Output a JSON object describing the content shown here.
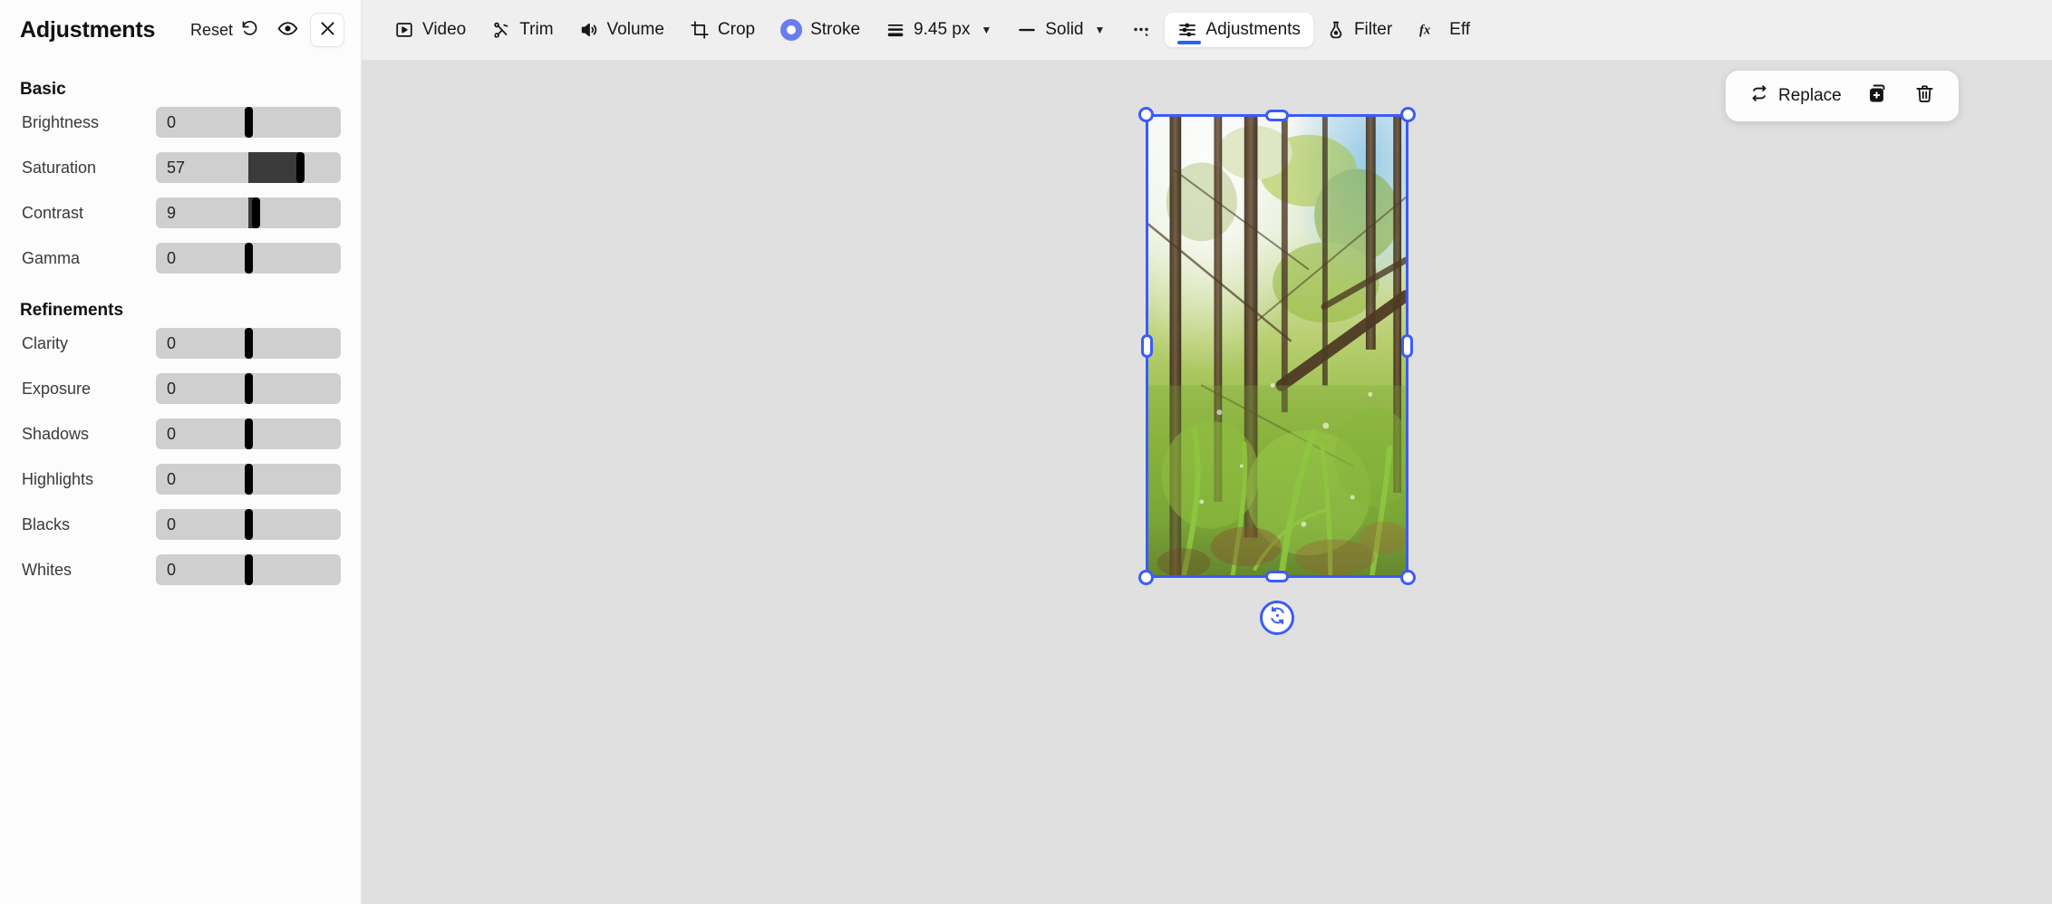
{
  "panel": {
    "title": "Adjustments",
    "reset_label": "Reset",
    "reset_icon": "undo-arrow-icon",
    "preview_icon": "eye-icon",
    "close_icon": "close-x-icon",
    "sections": [
      {
        "heading": "Basic",
        "sliders": [
          {
            "label": "Brightness",
            "value": "0",
            "pct": 50,
            "min": -100,
            "max": 100
          },
          {
            "label": "Saturation",
            "value": "57",
            "pct": 78,
            "min": -100,
            "max": 100
          },
          {
            "label": "Contrast",
            "value": "9",
            "pct": 54,
            "min": -100,
            "max": 100
          },
          {
            "label": "Gamma",
            "value": "0",
            "pct": 50,
            "min": -100,
            "max": 100
          }
        ]
      },
      {
        "heading": "Refinements",
        "sliders": [
          {
            "label": "Clarity",
            "value": "0",
            "pct": 50,
            "min": -100,
            "max": 100
          },
          {
            "label": "Exposure",
            "value": "0",
            "pct": 50,
            "min": -100,
            "max": 100
          },
          {
            "label": "Shadows",
            "value": "0",
            "pct": 50,
            "min": -100,
            "max": 100
          },
          {
            "label": "Highlights",
            "value": "0",
            "pct": 50,
            "min": -100,
            "max": 100
          },
          {
            "label": "Blacks",
            "value": "0",
            "pct": 50,
            "min": -100,
            "max": 100
          },
          {
            "label": "Whites",
            "value": "0",
            "pct": 50,
            "min": -100,
            "max": 100
          }
        ]
      }
    ]
  },
  "toolbar": {
    "items": [
      {
        "label": "Video",
        "icon": "video-play-icon",
        "active": false,
        "caret": false
      },
      {
        "label": "Trim",
        "icon": "scissors-trim-icon",
        "active": false,
        "caret": false
      },
      {
        "label": "Volume",
        "icon": "speaker-volume-icon",
        "active": false,
        "caret": false
      },
      {
        "label": "Crop",
        "icon": "crop-icon",
        "active": false,
        "caret": false
      },
      {
        "label": "Stroke",
        "icon": "stroke-color-swatch",
        "active": false,
        "caret": false
      },
      {
        "label": "9.45 px",
        "icon": "stroke-width-icon",
        "active": false,
        "caret": true
      },
      {
        "label": "Solid",
        "icon": "line-style-icon",
        "active": false,
        "caret": true
      },
      {
        "label": "",
        "icon": "more-options-icon",
        "active": false,
        "caret": false
      },
      {
        "label": "Adjustments",
        "icon": "adjustments-icon",
        "active": true,
        "caret": false
      },
      {
        "label": "Filter",
        "icon": "filter-flask-icon",
        "active": false,
        "caret": false
      },
      {
        "label": "Eff",
        "icon": "effects-fx-icon",
        "active": false,
        "caret": false
      }
    ],
    "accent_color": "#2563f0",
    "stroke_swatch_color": "#6b7cf0",
    "background": "#efefef"
  },
  "float_bar": {
    "replace_label": "Replace",
    "replace_icon": "swap-arrows-icon",
    "duplicate_icon": "duplicate-plus-icon",
    "delete_icon": "trash-icon"
  },
  "canvas": {
    "background": "#e0e0e0",
    "selection": {
      "border_color": "#3b5bfc",
      "rotate_icon": "rotate-icon",
      "media": "forest-photo"
    }
  }
}
